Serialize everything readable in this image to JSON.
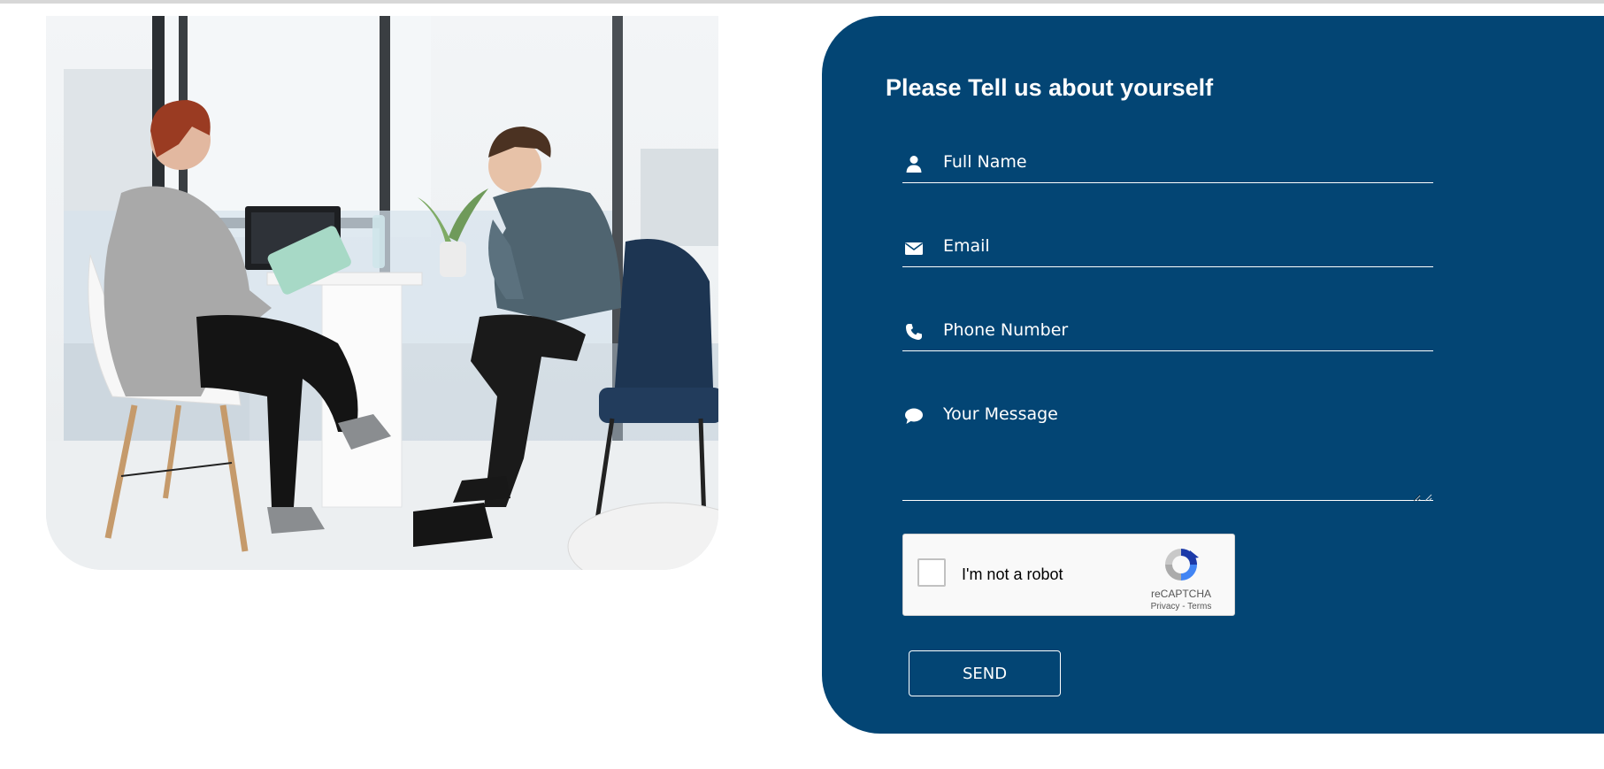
{
  "form": {
    "title": "Please Tell us about yourself",
    "fields": {
      "name": {
        "placeholder": "Full Name",
        "icon": "user-icon"
      },
      "email": {
        "placeholder": "Email",
        "icon": "envelope-icon"
      },
      "phone": {
        "placeholder": "Phone Number",
        "icon": "phone-icon"
      },
      "message": {
        "placeholder": "Your Message",
        "icon": "speech-bubble-icon"
      }
    },
    "recaptcha": {
      "label": "I'm not a robot",
      "brand": "reCAPTCHA",
      "privacy_link": "Privacy",
      "separator": " - ",
      "terms_link": "Terms"
    },
    "send_label": "SEND"
  },
  "colors": {
    "panel_bg": "#034574",
    "text": "#ffffff",
    "page_bg": "#ffffff"
  }
}
